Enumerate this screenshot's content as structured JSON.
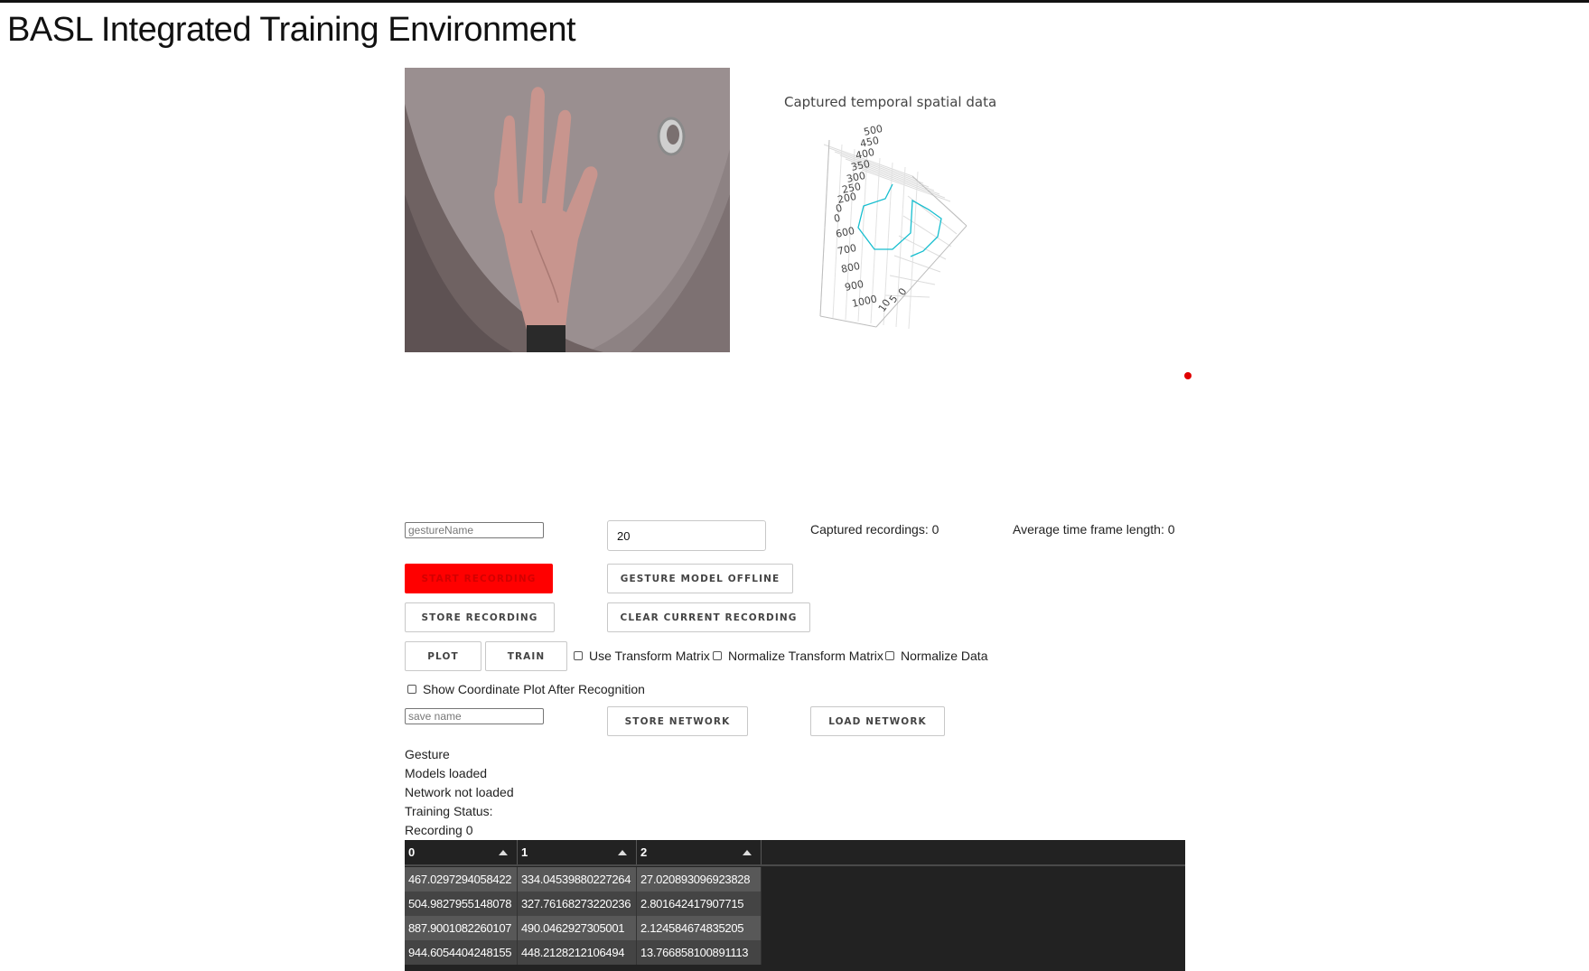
{
  "app": {
    "title": "BASL Integrated Training Environment"
  },
  "plot": {
    "title": "Captured temporal spatial data",
    "axis_ticks_a": [
      "500",
      "450",
      "400",
      "350",
      "300",
      "250",
      "200",
      "0",
      "0"
    ],
    "axis_ticks_b": [
      "600",
      "700",
      "800",
      "900",
      "1000"
    ],
    "axis_ticks_c": [
      "0",
      "5",
      "10"
    ],
    "line_color": "#17becf"
  },
  "controls": {
    "gesture_name_placeholder": "gestureName",
    "frame_count_value": "20",
    "captured_recordings": "Captured recordings: 0",
    "average_frame_length": "Average time frame length: 0",
    "start_recording": "Start Recording",
    "gesture_model_offline": "Gesture Model Offline",
    "store_recording": "Store Recording",
    "clear_current_recording": "Clear Current Recording",
    "plot": "Plot",
    "train": "Train",
    "use_transform_matrix": "Use Transform Matrix",
    "normalize_transform_matrix": "Normalize Transform Matrix",
    "normalize_data": "Normalize Data",
    "show_coordinate_plot": "Show Coordinate Plot After Recognition",
    "save_name_placeholder": "save name",
    "store_network": "Store Network",
    "load_network": "Load Network"
  },
  "status": {
    "gesture": "Gesture",
    "models": "Models loaded",
    "network": "Network not loaded",
    "training": "Training Status:",
    "recording": "Recording 0"
  },
  "table": {
    "headers": [
      "0",
      "1",
      "2"
    ],
    "rows": [
      [
        "467.0297294058422",
        "334.04539880227264",
        "27.020893096923828"
      ],
      [
        "504.9827955148078",
        "327.76168273220236",
        "2.801642417907715"
      ],
      [
        "887.9001082260107",
        "490.0462927305001",
        "2.124584674835205"
      ],
      [
        "944.6054404248155",
        "448.2128212106494",
        "13.766858100891113"
      ]
    ]
  },
  "colors": {
    "accent_red": "#ff0000",
    "grid_bg": "#222222",
    "row_odd": "#585858",
    "row_even": "#444444"
  }
}
